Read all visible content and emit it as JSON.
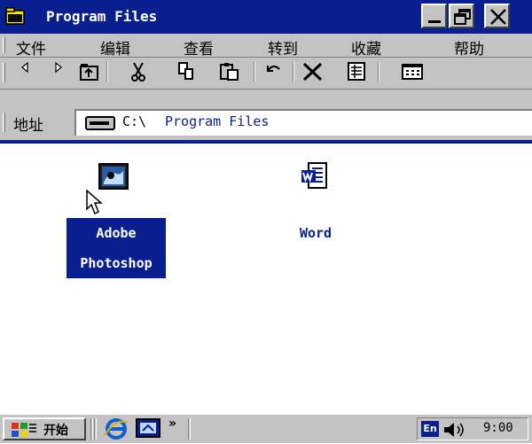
{
  "window": {
    "title": "Program Files"
  },
  "menu": {
    "items": [
      "文件",
      "编辑",
      "查看",
      "转到",
      "收藏",
      "帮助"
    ]
  },
  "toolbar": {
    "icons": [
      "back-icon",
      "forward-icon",
      "up-folder-icon",
      "cut-icon",
      "copy-icon",
      "paste-icon",
      "undo-icon",
      "delete-icon",
      "properties-icon",
      "views-icon"
    ]
  },
  "address": {
    "label": "地址",
    "drive": "C:\\",
    "folder": "Program Files"
  },
  "files": [
    {
      "line1": "Adobe",
      "line2": "Photoshop",
      "selected": true,
      "icon": "photoshop-icon"
    },
    {
      "line1": "Word",
      "line2": "",
      "selected": false,
      "icon": "word-icon"
    }
  ],
  "taskbar": {
    "start_label": "开始",
    "language": "En",
    "clock": "9:00",
    "overflow": "»"
  },
  "colors": {
    "title_bar": "#0a1f8f",
    "face": "#c3c3c3",
    "selection": "#0a1f8f"
  }
}
